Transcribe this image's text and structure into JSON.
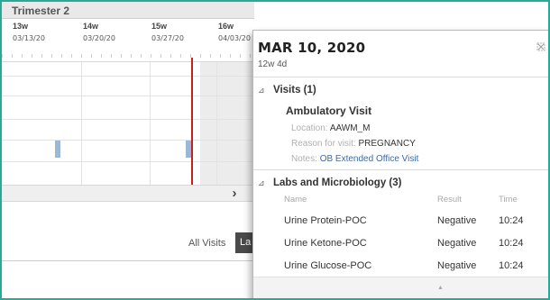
{
  "timeline": {
    "trimester_label": "Trimester 2",
    "weeks": [
      {
        "week": "13w",
        "date": "03/13/20"
      },
      {
        "week": "14w",
        "date": "03/20/20"
      },
      {
        "week": "15w",
        "date": "03/27/20"
      },
      {
        "week": "16w",
        "date": "04/03/20"
      }
    ],
    "scroll_right_glyph": "›",
    "filters": {
      "all_visits": "All Visits",
      "labs": "La"
    }
  },
  "popup": {
    "date": "MAR 10, 2020",
    "gestational_age": "12w 4d",
    "close_icon": "close-icon",
    "visits": {
      "heading": "Visits (1)",
      "expanded": true,
      "visit_name": "Ambulatory Visit",
      "location_label": "Location: ",
      "location_value": "AAWM_M",
      "reason_label": "Reason for visit: ",
      "reason_value": "PREGNANCY",
      "notes_label": "Notes: ",
      "notes_value": "OB Extended Office Visit"
    },
    "labs": {
      "heading": "Labs and Microbiology (3)",
      "expanded": true,
      "columns": {
        "name": "Name",
        "result": "Result",
        "time": "Time"
      },
      "rows": [
        {
          "name": "Urine Protein-POC",
          "result": "Negative",
          "time": "10:24"
        },
        {
          "name": "Urine Ketone-POC",
          "result": "Negative",
          "time": "10:24"
        },
        {
          "name": "Urine Glucose-POC",
          "result": "Negative",
          "time": "10:24"
        }
      ]
    },
    "expand_glyph": "⊿",
    "scroll_up_glyph": "▲"
  },
  "colors": {
    "frame_border": "#2aa89a",
    "today_marker": "#c0221e",
    "event_bar": "#9ab7d6",
    "link": "#3a6aa8"
  }
}
